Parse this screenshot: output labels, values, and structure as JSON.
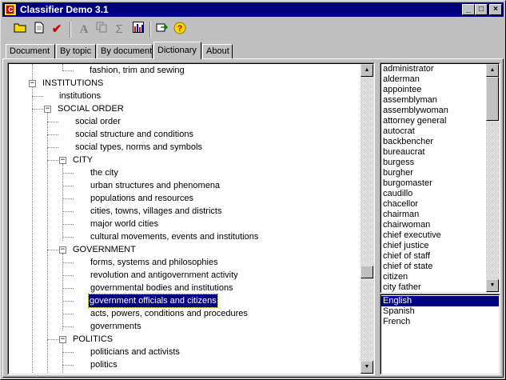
{
  "window": {
    "title": "Classifier Demo 3.1",
    "controls": [
      "_",
      "□",
      "×"
    ]
  },
  "toolbar": {
    "icons": [
      "open-folder-icon",
      "new-document-icon",
      "checkmark-icon",
      "font-icon",
      "copy-icon",
      "sigma-icon",
      "bar-chart-icon",
      "export-icon",
      "help-icon"
    ]
  },
  "tabs": [
    {
      "label": "Document"
    },
    {
      "label": "By topic"
    },
    {
      "label": "By document"
    },
    {
      "label": "Dictionary"
    },
    {
      "label": "About"
    }
  ],
  "active_tab": "Dictionary",
  "tree": {
    "nodes": [
      {
        "label": "fashion, trim and sewing"
      },
      {
        "label": "INSTITUTIONS"
      },
      {
        "label": "institutions"
      },
      {
        "label": "SOCIAL ORDER"
      },
      {
        "label": "social order"
      },
      {
        "label": "social structure and conditions"
      },
      {
        "label": "social types, norms and symbols"
      },
      {
        "label": "CITY"
      },
      {
        "label": "the city"
      },
      {
        "label": "urban structures and phenomena"
      },
      {
        "label": "populations and resources"
      },
      {
        "label": "cities, towns, villages and districts"
      },
      {
        "label": "major world cities"
      },
      {
        "label": "cultural movements, events and institutions"
      },
      {
        "label": "GOVERNMENT"
      },
      {
        "label": "forms, systems and philosophies"
      },
      {
        "label": "revolution and antigovernment activity"
      },
      {
        "label": "governmental bodies and institutions"
      },
      {
        "label": "government officials and citizens"
      },
      {
        "label": "acts, powers, conditions and procedures"
      },
      {
        "label": "governments"
      },
      {
        "label": "POLITICS"
      },
      {
        "label": "politicians and activists"
      },
      {
        "label": "politics"
      }
    ],
    "selected": "government officials and citizens",
    "expander_symbol": "−"
  },
  "words": [
    "administrator",
    "alderman",
    "appointee",
    "assemblyman",
    "assemblywoman",
    "attorney general",
    "autocrat",
    "backbencher",
    "bureaucrat",
    "burgess",
    "burgher",
    "burgomaster",
    "caudillo",
    "chacellor",
    "chairman",
    "chairwoman",
    "chief executive",
    "chief justice",
    "chief of staff",
    "chief of state",
    "citizen",
    "city father"
  ],
  "languages": [
    "English",
    "Spanish",
    "French"
  ],
  "selected_language": "English",
  "colors": {
    "title_bar": "#000080",
    "selection": "#000080",
    "face": "#c0c0c0"
  }
}
